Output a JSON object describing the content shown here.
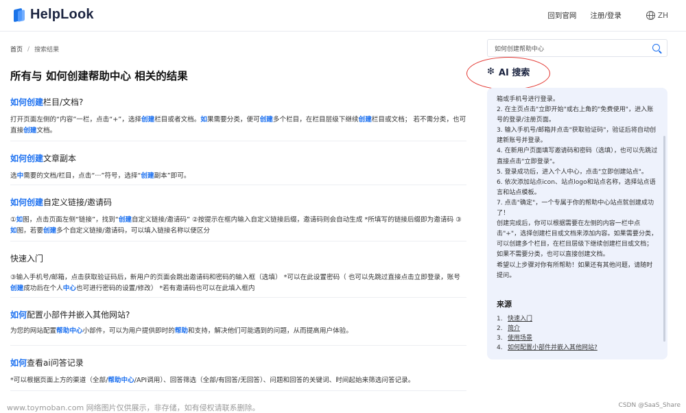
{
  "header": {
    "logo_text": "HelpLook",
    "nav": {
      "home_link": "回到官网",
      "auth_link": "注册/登录",
      "lang": "ZH"
    }
  },
  "breadcrumb": {
    "home": "首页",
    "separator": "/",
    "current": "搜索结果"
  },
  "page_title": "所有与 如何创建帮助中心 相关的结果",
  "results": [
    {
      "title": [
        {
          "t": "如何创建",
          "h": true
        },
        {
          "t": "栏目/文档?",
          "h": false
        }
      ],
      "desc": [
        {
          "t": "打开页面左侧的“内容”一栏，点击“+”，选择",
          "h": false
        },
        {
          "t": "创建",
          "h": true
        },
        {
          "t": "栏目或者文档。",
          "h": false
        },
        {
          "t": "如",
          "h": true
        },
        {
          "t": "果需要分类，便可",
          "h": false
        },
        {
          "t": "创建",
          "h": true
        },
        {
          "t": "多个栏目，在栏目层级下继续",
          "h": false
        },
        {
          "t": "创建",
          "h": true
        },
        {
          "t": "栏目或文档；  若不需分类，也可直接",
          "h": false
        },
        {
          "t": "创建",
          "h": true
        },
        {
          "t": "文档。",
          "h": false
        }
      ]
    },
    {
      "title": [
        {
          "t": "如何创建",
          "h": true
        },
        {
          "t": "文章副本",
          "h": false
        }
      ],
      "desc": [
        {
          "t": "选",
          "h": false
        },
        {
          "t": "中",
          "h": true
        },
        {
          "t": "需要的文档/栏目，点击“···”符号，选择“",
          "h": false
        },
        {
          "t": "创建",
          "h": true
        },
        {
          "t": "副本”即可。",
          "h": false
        }
      ]
    },
    {
      "title": [
        {
          "t": "如何创建",
          "h": true
        },
        {
          "t": "自定义链接/邀请码",
          "h": false
        }
      ],
      "desc": [
        {
          "t": "①",
          "h": false
        },
        {
          "t": "如",
          "h": true
        },
        {
          "t": "图，点击页面左侧“链接”，找到“",
          "h": false
        },
        {
          "t": "创建",
          "h": true
        },
        {
          "t": "自定义链接/邀请码” ②按提示在框内输入自定义链接后缀，邀请码则会自动生成 *所填写的链接后缀即为邀请码 ③",
          "h": false
        },
        {
          "t": "如",
          "h": true
        },
        {
          "t": "图，若要",
          "h": false
        },
        {
          "t": "创建",
          "h": true
        },
        {
          "t": "多个自定义链接/邀请码，可以填入链接名称以便区分",
          "h": false
        }
      ]
    },
    {
      "title": [
        {
          "t": "快速入门",
          "h": false
        }
      ],
      "desc": [
        {
          "t": "③输入手机号/邮箱，点击获取验证码后，新用户的页面会跳出邀请码和密码的输入框（选填） *可以在此设置密码（ 也可以先跳过直接点击立即登录，账号",
          "h": false
        },
        {
          "t": "创建",
          "h": true
        },
        {
          "t": "成功后在个人",
          "h": false
        },
        {
          "t": "中心",
          "h": true
        },
        {
          "t": "也可进行密码的设置/修改） *若有邀请码也可以在此填入框内",
          "h": false
        }
      ]
    },
    {
      "title": [
        {
          "t": "如何",
          "h": true
        },
        {
          "t": "配置小部件并嵌入其他网站?",
          "h": false
        }
      ],
      "desc": [
        {
          "t": "为您的网站配置",
          "h": false
        },
        {
          "t": "帮助中心",
          "h": true
        },
        {
          "t": "小部件，可以为用户提供即时的",
          "h": false
        },
        {
          "t": "帮助",
          "h": true
        },
        {
          "t": "和支持，解决他们可能遇到的问题，从而提高用户体验。",
          "h": false
        }
      ]
    },
    {
      "title": [
        {
          "t": "如何",
          "h": true
        },
        {
          "t": "查看ai问答记录",
          "h": false
        }
      ],
      "desc": [
        {
          "t": "*可以根据页面上方的渠道（全部/",
          "h": false
        },
        {
          "t": "帮助中心",
          "h": true
        },
        {
          "t": "/API调用）、回答筛选（全部/有回答/无回答）、问题和回答的关键词、时间起始来筛选问答记录。",
          "h": false
        }
      ]
    }
  ],
  "search": {
    "value": "如何创建帮助中心"
  },
  "ai": {
    "icon": "sparkle-icon",
    "title": "AI 搜索",
    "answer_lines": [
      "箱或手机号进行登录。",
      "2. 在主页点击\"立即开始\"或右上角的\"免费使用\"，进入账号的登录/注册页面。",
      "3. 输入手机号/邮箱并点击\"获取验证码\"，验证后将自动创建新账号并登录。",
      "4. 在新用户页面填写邀请码和密码（选填），也可以先跳过直接点击\"立即登录\"。",
      "5. 登录成功后，进入个人中心，点击\"立即创建站点\"。",
      "6. 依次添加站点icon、站点logo和站点名称，选择站点语言和站点模板。",
      "7. 点击\"确定\"，一个专属于你的帮助中心站点就创建成功了！",
      "创建完成后，你可以根据需要在左侧的内容一栏中点击\"+\"，选择创建栏目或文档来添加内容。如果需要分类，可以创建多个栏目，在栏目层级下继续创建栏目或文档；如果不需要分类，也可以直接创建文档。",
      "希望以上步骤对你有所帮助！如果还有其他问题，请随时提问。"
    ],
    "sources_title": "来源",
    "sources": [
      {
        "num": "1.",
        "label": "快速入门"
      },
      {
        "num": "2.",
        "label": "简介"
      },
      {
        "num": "3.",
        "label": "使用场景"
      },
      {
        "num": "4.",
        "label": "如何配置小部件并嵌入其他网站?"
      }
    ]
  },
  "watermark": {
    "left": "www.toymoban.com 网络图片仅供展示，非存储，如有侵权请联系删除。",
    "right": "CSDN @SaaS_Share"
  },
  "colors": {
    "accent": "#1a6ff0",
    "annotation": "#e2342e",
    "panel_bg": "#eef2fc"
  }
}
